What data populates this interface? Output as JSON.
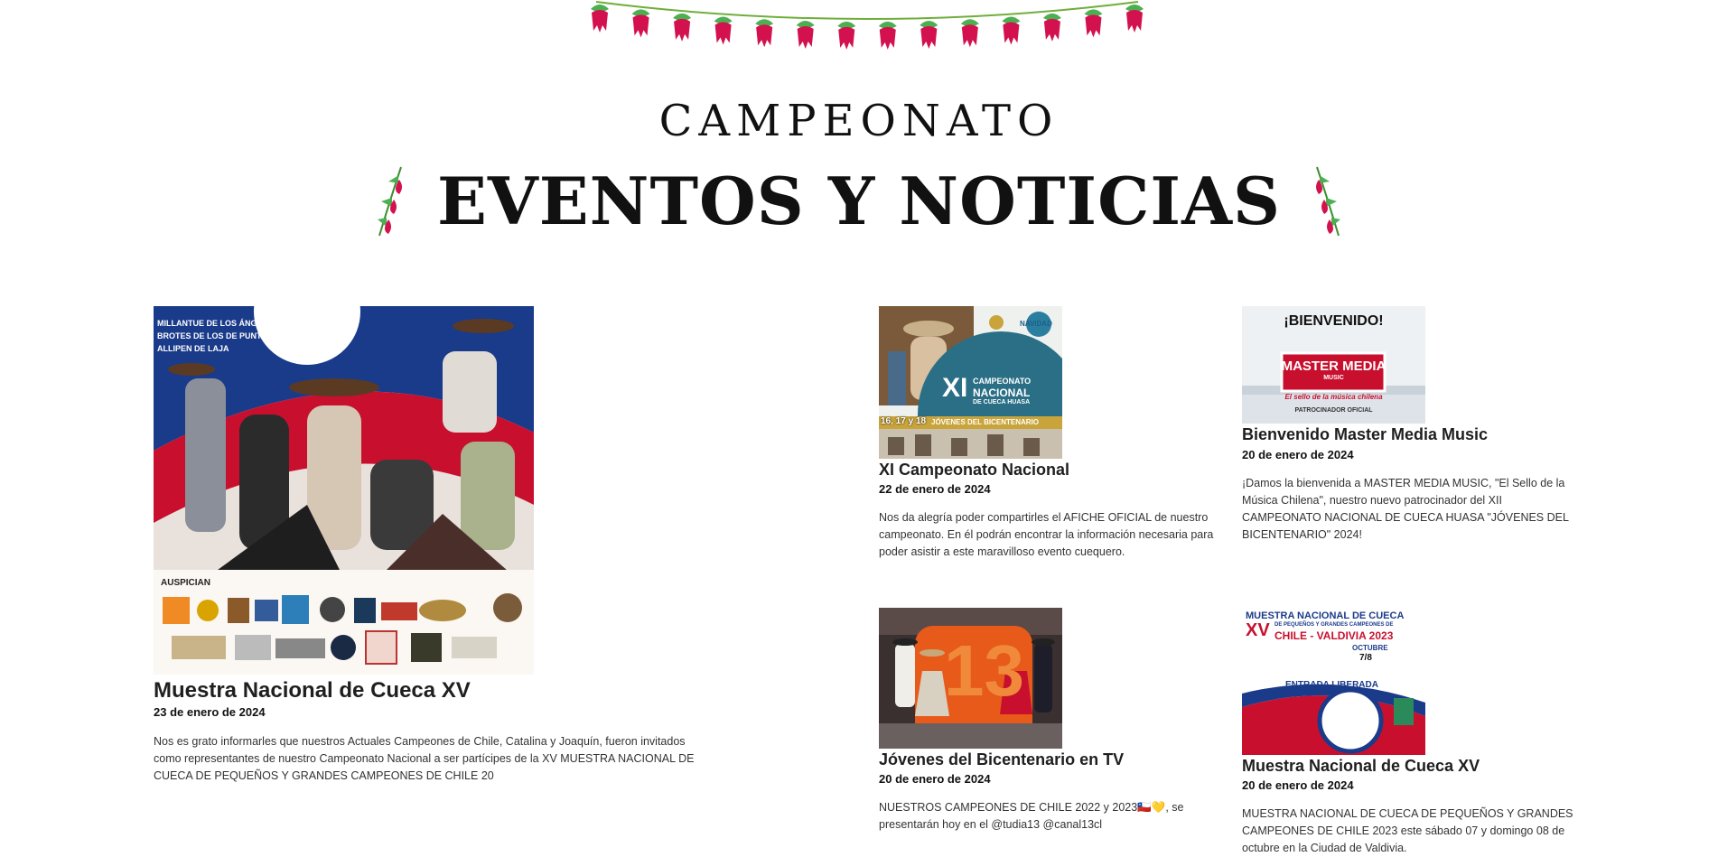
{
  "header": {
    "supertitle": "CAMPEONATO",
    "title": "EVENTOS Y NOTICIAS"
  },
  "colors": {
    "flower": "#d4114f",
    "leaf": "#4caf50",
    "flag_red": "#c8102e",
    "flag_blue": "#1a3a8a"
  },
  "posts": [
    {
      "title": "Muestra Nacional de Cueca XV",
      "date": "23 de enero de 2024",
      "excerpt": "Nos es grato informarles que nuestros Actuales Campeones de Chile, Catalina y Joaquín, fueron invitados como representantes de nuestro Campeonato Nacional a ser partícipes de la XV MUESTRA NACIONAL DE CUECA DE PEQUEÑOS Y GRANDES CAMPEONES DE CHILE 20",
      "image_text": {
        "line1": "MILLANTUE DE LOS ÁNGELES",
        "line2": "BROTES DE LOS DE PUNTA Y TACO",
        "line3": "ALLIPEN DE LAJA",
        "sponsors_label": "AUSPICIAN"
      }
    },
    {
      "title": "XI Campeonato Nacional",
      "date": "22 de enero de 2024",
      "excerpt": "Nos da alegría poder compartirles el AFICHE OFICIAL de nuestro campeonato. En él podrán encontrar la información necesaria para poder asistir a este maravilloso evento cuequero.",
      "image_text": {
        "badge": "XI",
        "line1": "CAMPEONATO",
        "line2": "NACIONAL",
        "line3": "DE CUECA HUASA",
        "ribbon": "JÓVENES DEL BICENTENARIO",
        "dates": "16, 17 y 18",
        "logo": "NAVIDAD"
      }
    },
    {
      "title": "Bienvenido Master Media Music",
      "date": "20 de enero de 2024",
      "excerpt": "¡Damos la bienvenida a MASTER MEDIA MUSIC, \"El Sello de la Música Chilena\", nuestro nuevo patrocinador del XII CAMPEONATO NACIONAL DE CUECA HUASA \"JÓVENES DEL BICENTENARIO\" 2024!",
      "image_text": {
        "heading": "¡BIENVENIDO!",
        "brand": "MASTER MEDIA",
        "brand_sub": "MUSIC",
        "slogan": "El sello de la música chilena",
        "footer": "PATROCINADOR OFICIAL"
      }
    },
    {
      "title": "Jóvenes del Bicentenario en TV",
      "date": "20 de enero de 2024",
      "excerpt": "NUESTROS CAMPEONES DE CHILE 2022 y 2023🇨🇱💛, se presentarán hoy en el @tudia13 @canal13cl",
      "image_text": {
        "number": "13"
      }
    },
    {
      "title": "Muestra Nacional de Cueca XV",
      "date": "20 de enero de 2024",
      "excerpt": "MUESTRA NACIONAL DE CUECA DE PEQUEÑOS Y GRANDES CAMPEONES DE CHILE 2023 este sábado 07 y domingo 08 de octubre en la Ciudad de Valdivia.",
      "image_text": {
        "line1": "MUESTRA NACIONAL DE CUECA",
        "roman": "XV",
        "line2": "DE PEQUEÑOS Y GRANDES CAMPEONES DE",
        "line3": "CHILE - VALDIVIA 2023",
        "month": "OCTUBRE",
        "days": "7/8",
        "entry": "ENTRADA LIBERADA"
      }
    }
  ]
}
